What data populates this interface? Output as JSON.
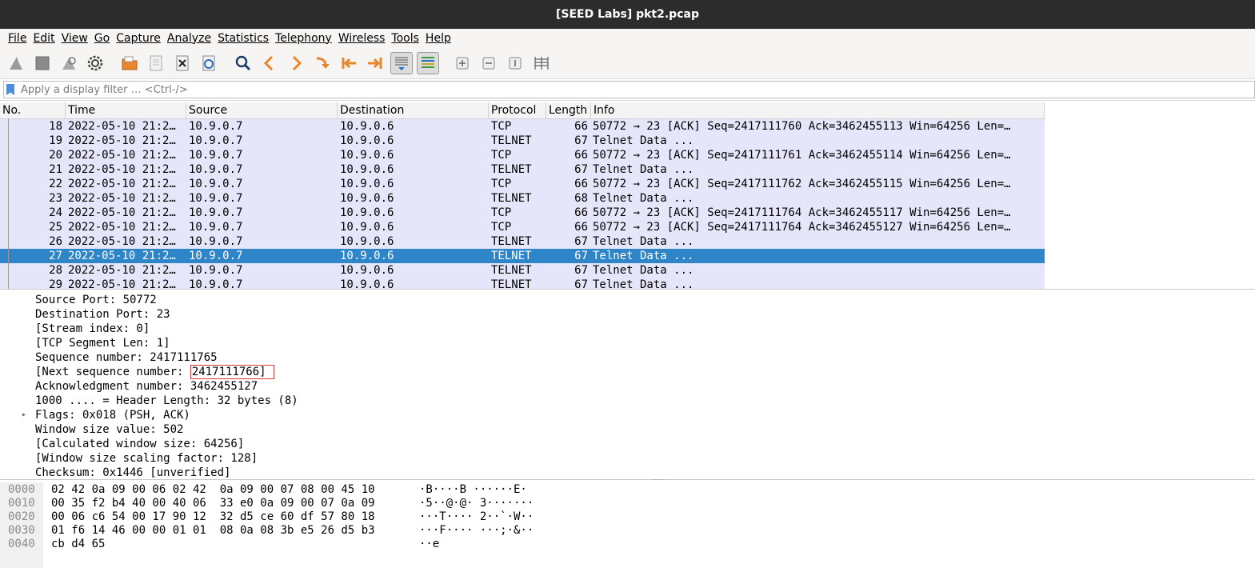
{
  "window": {
    "title": "[SEED Labs] pkt2.pcap"
  },
  "menu": [
    {
      "label": "File"
    },
    {
      "label": "Edit"
    },
    {
      "label": "View"
    },
    {
      "label": "Go"
    },
    {
      "label": "Capture"
    },
    {
      "label": "Analyze"
    },
    {
      "label": "Statistics"
    },
    {
      "label": "Telephony"
    },
    {
      "label": "Wireless"
    },
    {
      "label": "Tools"
    },
    {
      "label": "Help"
    }
  ],
  "toolbar": {
    "icons": [
      "shark-fin-start-icon",
      "stop-square-icon",
      "shark-fin-restart-icon",
      "gear-options-icon",
      "open-folder-icon",
      "save-file-icon",
      "close-file-icon",
      "reload-file-icon",
      "search-icon",
      "back-arrow-icon",
      "forward-arrow-icon",
      "go-to-packet-icon",
      "first-packet-icon",
      "last-packet-icon",
      "autoscroll-icon",
      "colorize-icon",
      "zoom-in-icon",
      "zoom-out-icon",
      "normal-size-icon",
      "resize-columns-icon"
    ]
  },
  "filter": {
    "placeholder": "Apply a display filter … <Ctrl-/>"
  },
  "packet_list": {
    "columns": [
      "No.",
      "Time",
      "Source",
      "Destination",
      "Protocol",
      "Length",
      "Info"
    ],
    "rows": [
      {
        "no": "18",
        "time": "2022-05-10 21:2…",
        "src": "10.9.0.7",
        "dst": "10.9.0.6",
        "proto": "TCP",
        "len": "66",
        "info": "50772 → 23 [ACK] Seq=2417111760 Ack=3462455113 Win=64256 Len=…"
      },
      {
        "no": "19",
        "time": "2022-05-10 21:2…",
        "src": "10.9.0.7",
        "dst": "10.9.0.6",
        "proto": "TELNET",
        "len": "67",
        "info": "Telnet Data ..."
      },
      {
        "no": "20",
        "time": "2022-05-10 21:2…",
        "src": "10.9.0.7",
        "dst": "10.9.0.6",
        "proto": "TCP",
        "len": "66",
        "info": "50772 → 23 [ACK] Seq=2417111761 Ack=3462455114 Win=64256 Len=…"
      },
      {
        "no": "21",
        "time": "2022-05-10 21:2…",
        "src": "10.9.0.7",
        "dst": "10.9.0.6",
        "proto": "TELNET",
        "len": "67",
        "info": "Telnet Data ..."
      },
      {
        "no": "22",
        "time": "2022-05-10 21:2…",
        "src": "10.9.0.7",
        "dst": "10.9.0.6",
        "proto": "TCP",
        "len": "66",
        "info": "50772 → 23 [ACK] Seq=2417111762 Ack=3462455115 Win=64256 Len=…"
      },
      {
        "no": "23",
        "time": "2022-05-10 21:2…",
        "src": "10.9.0.7",
        "dst": "10.9.0.6",
        "proto": "TELNET",
        "len": "68",
        "info": "Telnet Data ..."
      },
      {
        "no": "24",
        "time": "2022-05-10 21:2…",
        "src": "10.9.0.7",
        "dst": "10.9.0.6",
        "proto": "TCP",
        "len": "66",
        "info": "50772 → 23 [ACK] Seq=2417111764 Ack=3462455117 Win=64256 Len=…"
      },
      {
        "no": "25",
        "time": "2022-05-10 21:2…",
        "src": "10.9.0.7",
        "dst": "10.9.0.6",
        "proto": "TCP",
        "len": "66",
        "info": "50772 → 23 [ACK] Seq=2417111764 Ack=3462455127 Win=64256 Len=…"
      },
      {
        "no": "26",
        "time": "2022-05-10 21:2…",
        "src": "10.9.0.7",
        "dst": "10.9.0.6",
        "proto": "TELNET",
        "len": "67",
        "info": "Telnet Data ..."
      },
      {
        "no": "27",
        "time": "2022-05-10 21:2…",
        "src": "10.9.0.7",
        "dst": "10.9.0.6",
        "proto": "TELNET",
        "len": "67",
        "info": "Telnet Data ...",
        "selected": true
      },
      {
        "no": "28",
        "time": "2022-05-10 21:2…",
        "src": "10.9.0.7",
        "dst": "10.9.0.6",
        "proto": "TELNET",
        "len": "67",
        "info": "Telnet Data ..."
      },
      {
        "no": "29",
        "time": "2022-05-10 21:2…",
        "src": "10.9.0.7",
        "dst": "10.9.0.6",
        "proto": "TELNET",
        "len": "67",
        "info": "Telnet Data ..."
      }
    ]
  },
  "details": {
    "lines": [
      {
        "text": "Source Port: 50772"
      },
      {
        "text": "Destination Port: 23"
      },
      {
        "text": "[Stream index: 0]"
      },
      {
        "text": "[TCP Segment Len: 1]"
      },
      {
        "text": "Sequence number: 2417111765"
      },
      {
        "prefix": "[Next sequence number: ",
        "highlight": "2417111766]"
      },
      {
        "text": "Acknowledgment number: 3462455127"
      },
      {
        "text": "1000 .... = Header Length: 32 bytes (8)"
      },
      {
        "text": "Flags: 0x018 (PSH, ACK)",
        "expandable": true
      },
      {
        "text": "Window size value: 502"
      },
      {
        "text": "[Calculated window size: 64256]"
      },
      {
        "text": "[Window size scaling factor: 128]"
      },
      {
        "text": "Checksum: 0x1446 [unverified]"
      }
    ]
  },
  "bytes": {
    "rows": [
      {
        "offset": "0000",
        "hex": "02 42 0a 09 00 06 02 42  0a 09 00 07 08 00 45 10",
        "ascii": "·B····B ······E·"
      },
      {
        "offset": "0010",
        "hex": "00 35 f2 b4 40 00 40 06  33 e0 0a 09 00 07 0a 09",
        "ascii": "·5··@·@· 3·······"
      },
      {
        "offset": "0020",
        "hex": "00 06 c6 54 00 17 90 12  32 d5 ce 60 df 57 80 18",
        "ascii": "···T···· 2··`·W··"
      },
      {
        "offset": "0030",
        "hex": "01 f6 14 46 00 00 01 01  08 0a 08 3b e5 26 d5 b3",
        "ascii": "···F···· ···;·&··"
      },
      {
        "offset": "0040",
        "hex": "cb d4 65",
        "ascii": "··e"
      }
    ]
  },
  "colors": {
    "row_bg": "#e6e6fa",
    "selected_bg": "#2e85c8",
    "titlebar": "#2c2c2c",
    "highlight_box": "#d33a3a"
  }
}
